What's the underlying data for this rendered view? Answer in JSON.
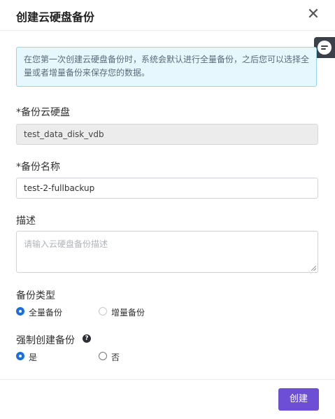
{
  "dialog": {
    "title": "创建云硬盘备份",
    "close_icon": "close-icon"
  },
  "side_button": {
    "icon": "chat-icon"
  },
  "notice": {
    "text": "在您第一次创建云硬盘备份时，系统会默认进行全量备份，之后您可以选择全量或者增量备份来保存您的数据。"
  },
  "fields": {
    "disk": {
      "label": "*备份云硬盘",
      "value": "test_data_disk_vdb"
    },
    "name": {
      "label": "*备份名称",
      "value": "test-2-fullbackup"
    },
    "description": {
      "label": "描述",
      "placeholder": "请输入云硬盘备份描述"
    }
  },
  "backup_type": {
    "label": "备份类型",
    "options": [
      {
        "label": "全量备份",
        "selected": true
      },
      {
        "label": "增量备份",
        "selected": false,
        "disabled": true
      }
    ]
  },
  "force_backup": {
    "label": "强制创建备份",
    "help_icon": "question-icon",
    "options": [
      {
        "label": "是",
        "selected": true
      },
      {
        "label": "否",
        "selected": false
      }
    ]
  },
  "footer": {
    "create_label": "创建"
  },
  "colors": {
    "accent": "#6d4fd6",
    "radio_checked": "#1a6fe0",
    "notice_bg": "#e6f7fd"
  }
}
